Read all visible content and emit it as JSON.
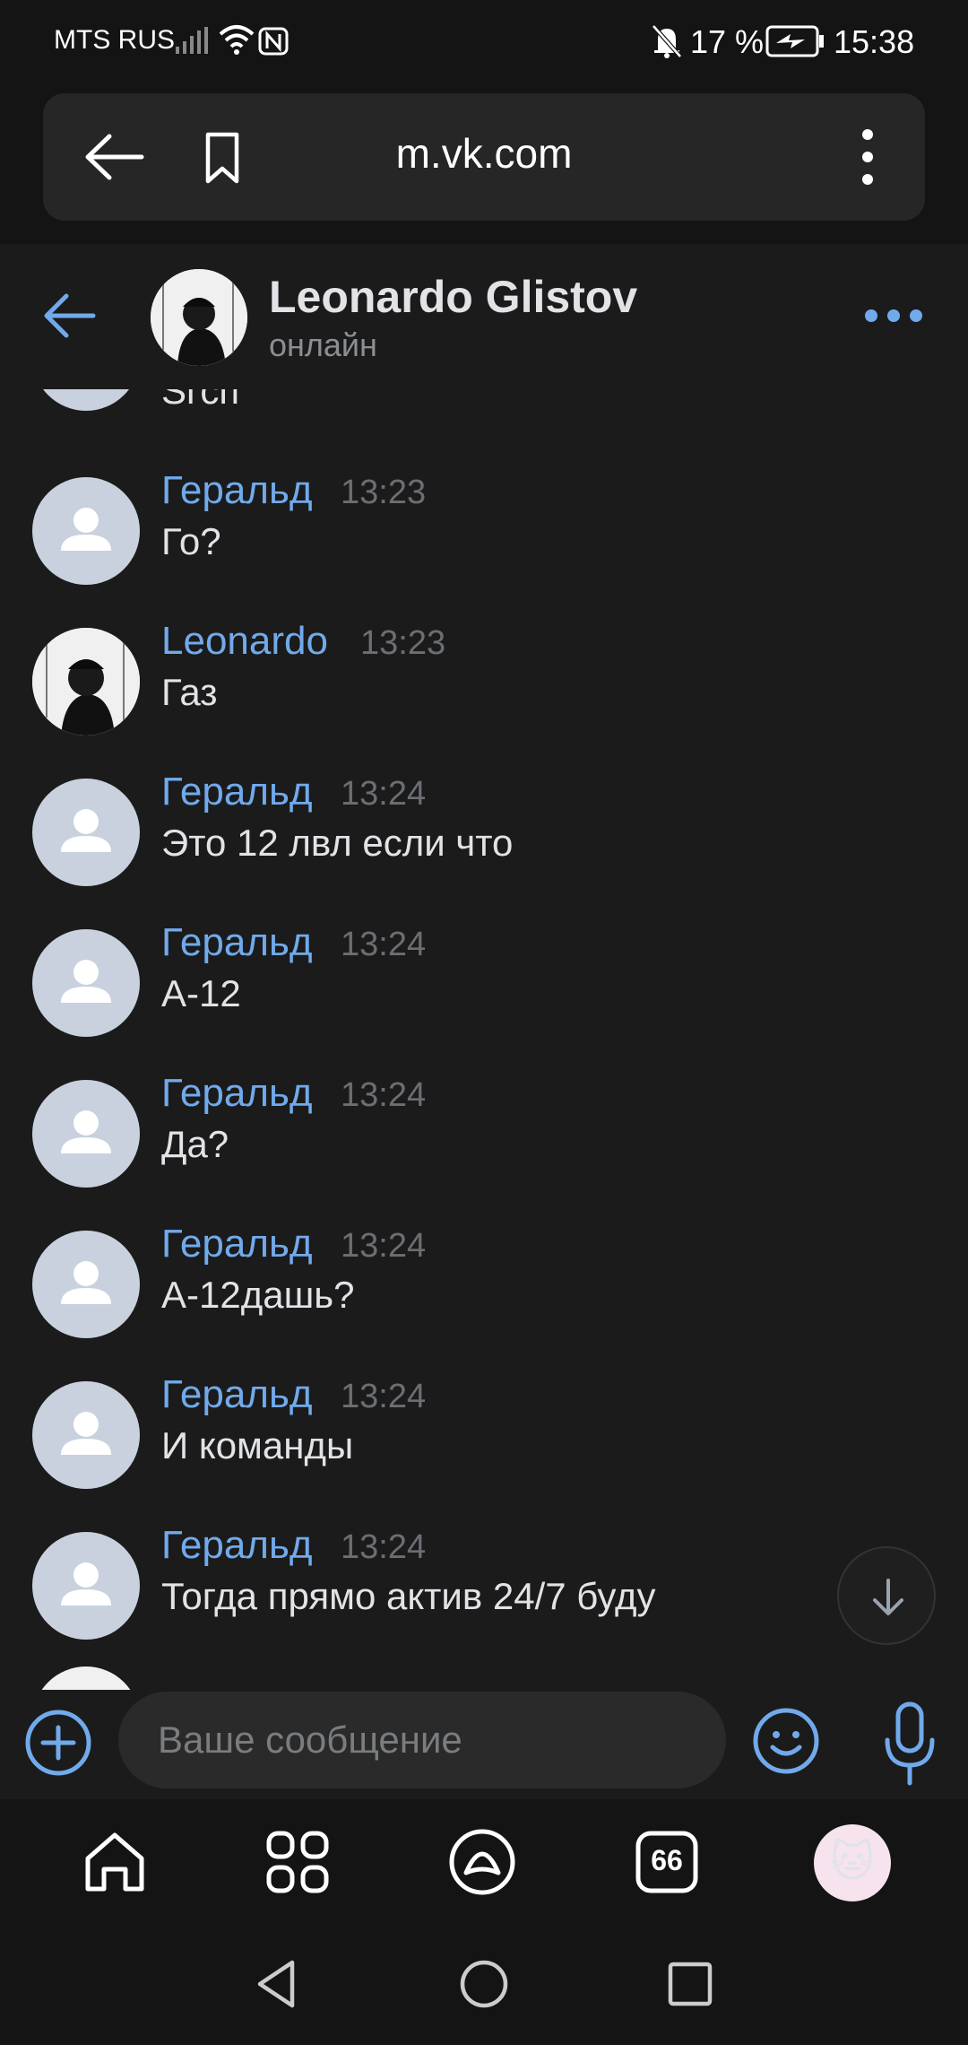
{
  "status_bar": {
    "carrier": "MTS RUS",
    "battery_percent": "17 %",
    "time": "15:38"
  },
  "browser": {
    "url": "m.vk.com"
  },
  "chat": {
    "name": "Leonardo Glistov",
    "status": "онлайн",
    "partial_top_text": "Sгcп"
  },
  "messages": [
    {
      "sender": "Геральд",
      "time": "13:23",
      "text": "Го?",
      "avatar": "default"
    },
    {
      "sender": "Leonardo",
      "time": "13:23",
      "text": "Газ",
      "avatar": "photo"
    },
    {
      "sender": "Геральд",
      "time": "13:24",
      "text": "Это 12 лвл если что",
      "avatar": "default"
    },
    {
      "sender": "Геральд",
      "time": "13:24",
      "text": "А-12",
      "avatar": "default"
    },
    {
      "sender": "Геральд",
      "time": "13:24",
      "text": "Да?",
      "avatar": "default"
    },
    {
      "sender": "Геральд",
      "time": "13:24",
      "text": "А-12дашь?",
      "avatar": "default"
    },
    {
      "sender": "Геральд",
      "time": "13:24",
      "text": "И команды",
      "avatar": "default"
    },
    {
      "sender": "Геральд",
      "time": "13:24",
      "text": "Тогда прямо актив 24/7 буду",
      "avatar": "default"
    }
  ],
  "composer": {
    "placeholder": "Ваше сообщение"
  },
  "bottom_nav": {
    "messenger_badge": "66",
    "profile_emoji": "🐱"
  },
  "colors": {
    "accent": "#71aaeb",
    "background": "#1b1b1b",
    "text": "#e1e3e6"
  }
}
